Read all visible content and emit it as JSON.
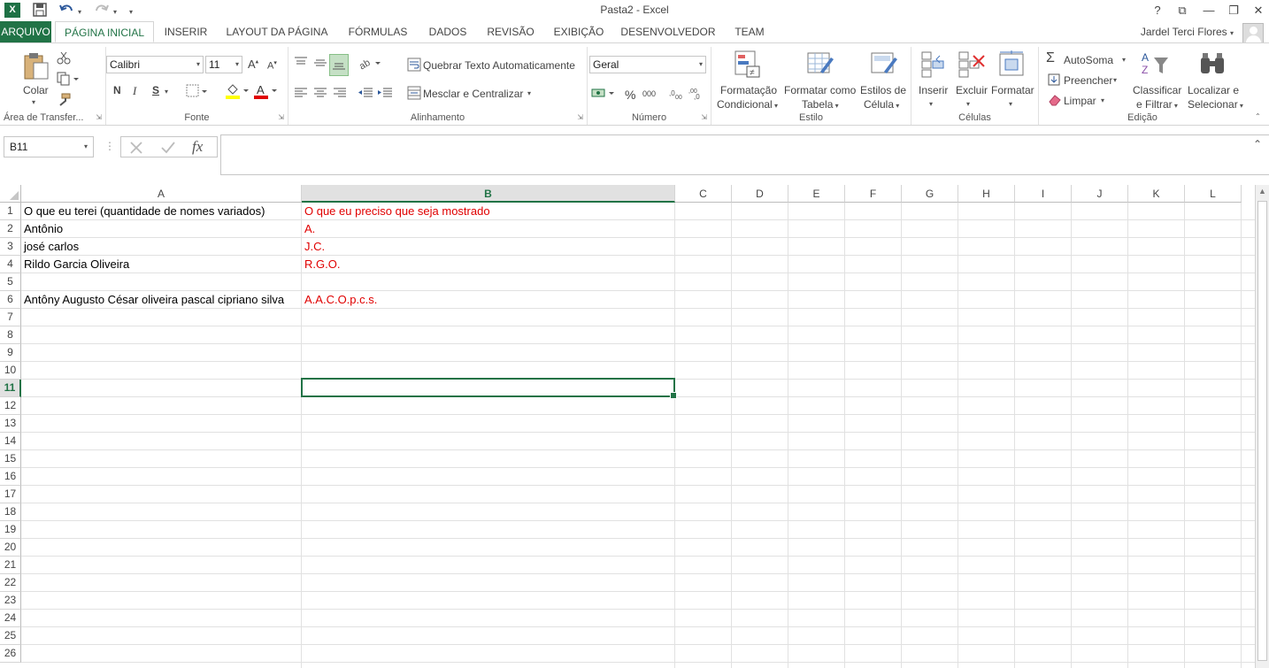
{
  "window": {
    "title": "Pasta2 - Excel",
    "app_icon": "X",
    "user_name": "Jardel Terci Flores",
    "controls": {
      "help": "?",
      "ribbon_display": "⧉",
      "minimize": "—",
      "restore": "❐",
      "close": "✕"
    }
  },
  "qat": {
    "save_icon": "save-icon",
    "undo_icon": "undo-icon",
    "redo_icon": "redo-icon",
    "customize": "▾"
  },
  "tabs": [
    {
      "label": "ARQUIVO"
    },
    {
      "label": "PÁGINA INICIAL"
    },
    {
      "label": "INSERIR"
    },
    {
      "label": "LAYOUT DA PÁGINA"
    },
    {
      "label": "FÓRMULAS"
    },
    {
      "label": "DADOS"
    },
    {
      "label": "REVISÃO"
    },
    {
      "label": "EXIBIÇÃO"
    },
    {
      "label": "DESENVOLVEDOR"
    },
    {
      "label": "TEAM"
    }
  ],
  "ribbon": {
    "clipboard": {
      "label": "Área de Transfer...",
      "paste": "Colar"
    },
    "font": {
      "label": "Fonte",
      "name": "Calibri",
      "size": "11",
      "bold": "N",
      "italic": "I",
      "underline": "S"
    },
    "alignment": {
      "label": "Alinhamento",
      "wrap": "Quebrar Texto Automaticamente",
      "merge": "Mesclar e Centralizar"
    },
    "number": {
      "label": "Número",
      "format": "Geral",
      "percent": "%",
      "thousands": "000"
    },
    "styles": {
      "label": "Estilo",
      "conditional_1": "Formatação",
      "conditional_2": "Condicional",
      "table_1": "Formatar como",
      "table_2": "Tabela",
      "cell_1": "Estilos de",
      "cell_2": "Célula"
    },
    "cells": {
      "label": "Células",
      "insert": "Inserir",
      "delete": "Excluir",
      "format": "Formatar"
    },
    "editing": {
      "label": "Edição",
      "autosum": "AutoSoma",
      "fill": "Preencher",
      "clear": "Limpar",
      "sort_1": "Classificar",
      "sort_2": "e Filtrar",
      "find_1": "Localizar e",
      "find_2": "Selecionar"
    }
  },
  "formula_bar": {
    "name_box": "B11",
    "fx": "fx",
    "formula": ""
  },
  "sheet": {
    "columns": [
      "A",
      "B",
      "C",
      "D",
      "E",
      "F",
      "G",
      "H",
      "I",
      "J",
      "K",
      "L"
    ],
    "rows": [
      "1",
      "2",
      "3",
      "4",
      "5",
      "6",
      "7",
      "8",
      "9",
      "10",
      "11",
      "12",
      "13",
      "14",
      "15",
      "16",
      "17",
      "18",
      "19",
      "20",
      "21",
      "22",
      "23",
      "24",
      "25",
      "26"
    ],
    "selected_column": "B",
    "selected_row": "11",
    "cells": {
      "A1": "O que eu terei (quantidade de nomes variados)",
      "B1": "O que eu preciso que seja mostrado",
      "A2": "Antônio",
      "B2": "A.",
      "A3": "josé carlos",
      "B3": "J.C.",
      "A4": "Rildo Garcia Oliveira",
      "B4": "R.G.O.",
      "A6": "Antôny Augusto César oliveira pascal cipriano silva",
      "B6": "A.A.C.O.p.c.s."
    },
    "text_color_col_b": "#e00000",
    "accent": "#217346"
  }
}
